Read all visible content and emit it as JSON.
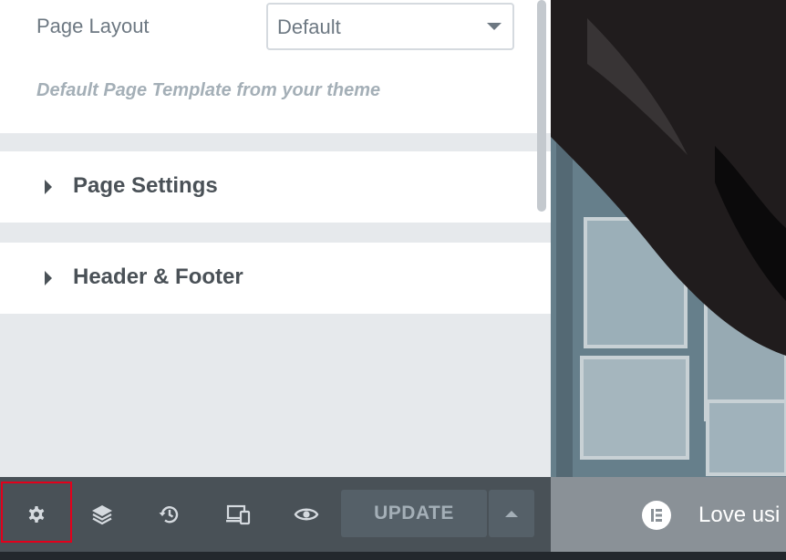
{
  "page_layout": {
    "label": "Page Layout",
    "select_value": "Default",
    "description": "Default Page Template from your theme"
  },
  "sections": [
    {
      "title": "Page Settings"
    },
    {
      "title": "Header & Footer"
    }
  ],
  "footer": {
    "tools": [
      {
        "icon": "gear-icon",
        "label": "Settings"
      },
      {
        "icon": "layers-icon",
        "label": "Navigator"
      },
      {
        "icon": "history-icon",
        "label": "History"
      },
      {
        "icon": "responsive-icon",
        "label": "Responsive Mode"
      },
      {
        "icon": "eye-icon",
        "label": "Preview Changes"
      }
    ],
    "update_label": "UPDATE"
  },
  "notice": {
    "text": "Love usi"
  },
  "colors": {
    "panel_bg": "#e6e9ec",
    "footer_bg": "#495157",
    "highlight": "#e3001b",
    "text_muted": "#6d7882"
  }
}
